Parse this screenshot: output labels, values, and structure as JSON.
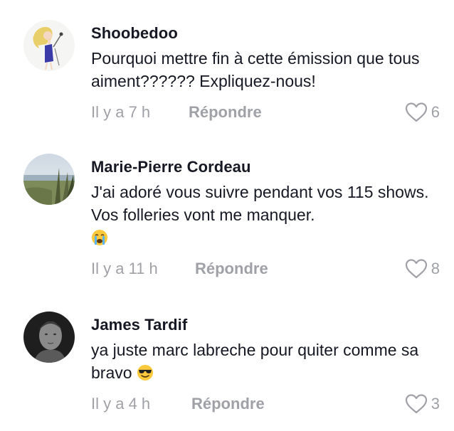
{
  "comments": [
    {
      "author": "Shoobedoo",
      "text": "Pourquoi mettre fin à cette émission que tous aiment?????? Expliquez-nous!",
      "time": "Il y a 7 h",
      "reply_label": "Répondre",
      "likes": "6"
    },
    {
      "author": "Marie-Pierre Cordeau",
      "text": "J'ai adoré vous suivre pendant vos 115 shows. Vos folleries vont me manquer.",
      "emoji": "crying-face",
      "time": "Il y a 11 h",
      "reply_label": "Répondre",
      "likes": "8"
    },
    {
      "author": "James Tardif",
      "text": "ya juste marc labreche pour quiter comme sa bravo",
      "emoji": "sunglasses-face",
      "time": "Il y a 4 h",
      "reply_label": "Répondre",
      "likes": "3"
    }
  ],
  "colors": {
    "text": "#161823",
    "muted": "#a0a1a7",
    "background": "#ffffff"
  },
  "icons": {
    "like": "heart-outline-icon"
  }
}
